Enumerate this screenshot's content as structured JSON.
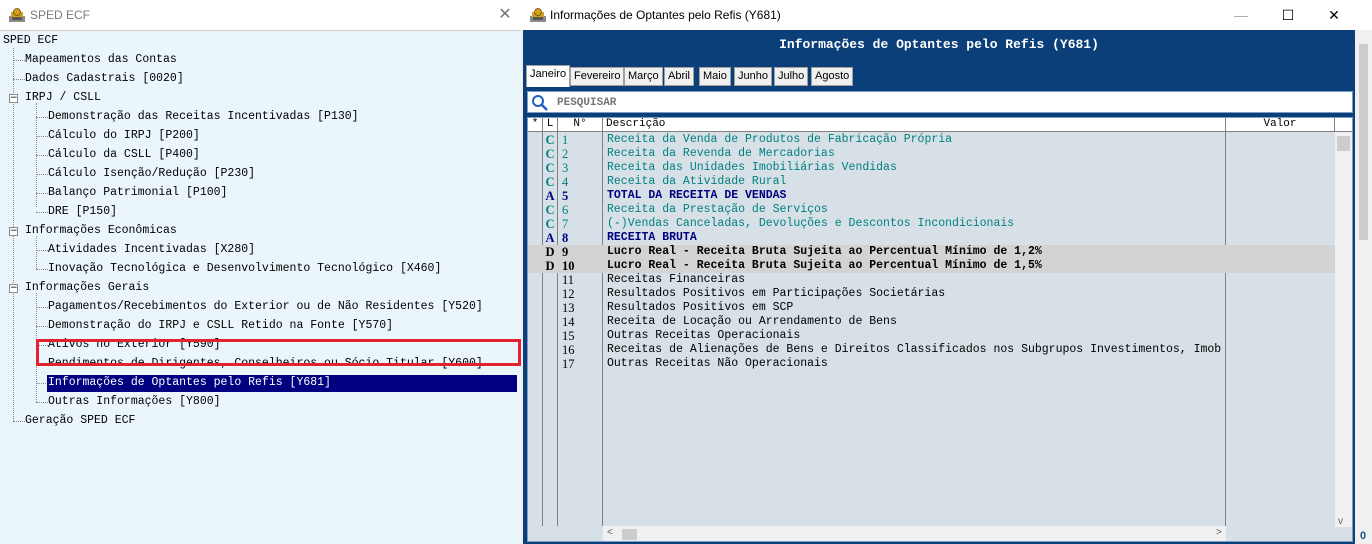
{
  "left_window": {
    "title": "SPED ECF",
    "close_glyph": "✕",
    "tree": [
      {
        "label": "SPED ECF"
      },
      {
        "label": "Mapeamentos das Contas"
      },
      {
        "label": "Dados Cadastrais [0020]"
      },
      {
        "label": "IRPJ / CSLL"
      },
      {
        "label": "Demonstração das Receitas Incentivadas [P130]"
      },
      {
        "label": "Cálculo do IRPJ [P200]"
      },
      {
        "label": "Cálculo da CSLL [P400]"
      },
      {
        "label": "Cálculo Isenção/Redução [P230]"
      },
      {
        "label": "Balanço Patrimonial [P100]"
      },
      {
        "label": "DRE [P150]"
      },
      {
        "label": "Informações Econômicas"
      },
      {
        "label": "Atividades Incentivadas [X280]"
      },
      {
        "label": "Inovação Tecnológica e Desenvolvimento Tecnológico [X460]"
      },
      {
        "label": "Informações Gerais"
      },
      {
        "label": "Pagamentos/Recebimentos do Exterior ou de Não Residentes [Y520]"
      },
      {
        "label": "Demonstração do IRPJ e CSLL Retido na Fonte [Y570]"
      },
      {
        "label": "Ativos no Exterior [Y590]"
      },
      {
        "label": "Rendimentos de Dirigentes, Conselheiros ou Sócio Titular [Y600]"
      },
      {
        "label": "Informações de Optantes pelo Refis [Y681]",
        "selected": true
      },
      {
        "label": "Outras Informações [Y800]"
      },
      {
        "label": "Geração SPED ECF"
      }
    ],
    "expander_glyph": "−"
  },
  "right_window": {
    "title": "Informações de Optantes pelo Refis (Y681)",
    "minimize_glyph": "—",
    "maximize_glyph": "☐",
    "close_glyph": "✕",
    "header": "Informações de Optantes pelo Refis (Y681)",
    "tabs": [
      "Janeiro",
      "Fevereiro",
      "Março",
      "Abril",
      "Maio",
      "Junho",
      "Julho",
      "Agosto"
    ],
    "active_tab": "Janeiro",
    "search_placeholder": "PESQUISAR",
    "columns": {
      "star": "*",
      "l": "L",
      "n": "N°",
      "descricao": "Descrição",
      "valor": "Valor"
    },
    "rows": [
      {
        "l": "C",
        "n": "1",
        "d": "Receita da Venda de Produtos de Fabricação Própria",
        "style": "teal"
      },
      {
        "l": "C",
        "n": "2",
        "d": "Receita da Revenda de Mercadorias",
        "style": "teal"
      },
      {
        "l": "C",
        "n": "3",
        "d": "Receita das Unidades Imobiliárias Vendidas",
        "style": "teal"
      },
      {
        "l": "C",
        "n": "4",
        "d": "Receita da Atividade Rural",
        "style": "teal"
      },
      {
        "l": "A",
        "n": "5",
        "d": "TOTAL DA RECEITA DE VENDAS",
        "style": "blue"
      },
      {
        "l": "C",
        "n": "6",
        "d": "Receita da Prestação de Serviços",
        "style": "teal"
      },
      {
        "l": "C",
        "n": "7",
        "d": "(-)Vendas Canceladas, Devoluções e Descontos Incondicionais",
        "style": "teal"
      },
      {
        "l": "A",
        "n": "8",
        "d": "RECEITA BRUTA",
        "style": "blue"
      },
      {
        "l": "D",
        "n": "9",
        "d": "Lucro Real - Receita Bruta Sujeita ao Percentual Mínimo de 1,2%",
        "style": "black"
      },
      {
        "l": "D",
        "n": "10",
        "d": "Lucro Real - Receita Bruta Sujeita ao Percentual Mínimo de 1,5%",
        "style": "black"
      },
      {
        "l": "",
        "n": "11",
        "d": "Receitas Financeiras",
        "style": "plain"
      },
      {
        "l": "",
        "n": "12",
        "d": "Resultados Positivos em Participações Societárias",
        "style": "plain"
      },
      {
        "l": "",
        "n": "13",
        "d": "Resultados Positivos em SCP",
        "style": "plain"
      },
      {
        "l": "",
        "n": "14",
        "d": "Receita de Locação ou Arrendamento de Bens",
        "style": "plain"
      },
      {
        "l": "",
        "n": "15",
        "d": "Outras Receitas Operacionais",
        "style": "plain"
      },
      {
        "l": "",
        "n": "16",
        "d": "Receitas de Alienações de Bens e Direitos Classificados nos Subgrupos Investimentos, Imob",
        "style": "plain"
      },
      {
        "l": "",
        "n": "17",
        "d": "Outras Receitas Não Operacionais",
        "style": "plain"
      }
    ],
    "scroll_left": "<",
    "scroll_right": ">",
    "scroll_up": "^",
    "scroll_down": "v",
    "outer_zero": "0"
  }
}
